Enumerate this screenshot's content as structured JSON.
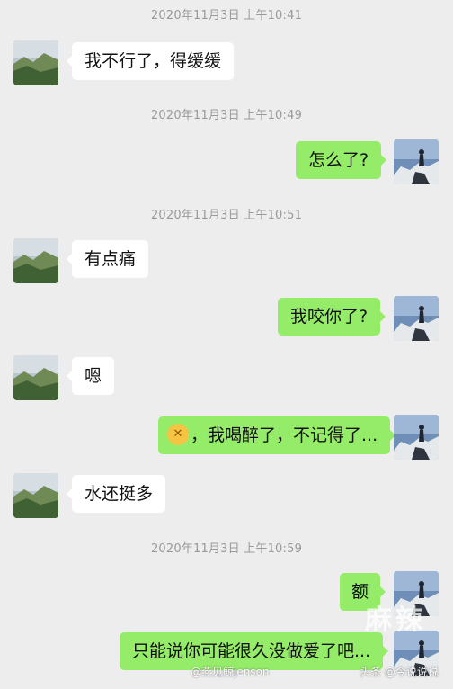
{
  "messages": [
    {
      "kind": "timestamp",
      "text": "2020年11月3日 上午10:41"
    },
    {
      "kind": "incoming",
      "text": "我不行了，得缓缓"
    },
    {
      "kind": "timestamp",
      "text": "2020年11月3日 上午10:49"
    },
    {
      "kind": "outgoing",
      "text": "怎么了?"
    },
    {
      "kind": "timestamp",
      "text": "2020年11月3日 上午10:51"
    },
    {
      "kind": "incoming",
      "text": "有点痛"
    },
    {
      "kind": "outgoing",
      "text": "我咬你了?"
    },
    {
      "kind": "incoming",
      "text": "嗯"
    },
    {
      "kind": "outgoing",
      "text": "，我喝醉了，不记得了...",
      "emoji": "dizzy-face-emoji"
    },
    {
      "kind": "incoming",
      "text": "水还挺多"
    },
    {
      "kind": "timestamp",
      "text": "2020年11月3日 上午10:59"
    },
    {
      "kind": "outgoing",
      "text": "额"
    },
    {
      "kind": "outgoing",
      "text": "只能说你可能很久没做爱了吧..."
    }
  ],
  "watermarks": {
    "logo": "麻辣",
    "weibo": "@燕见鲸jenson",
    "toutiao": "头条 @今说说说"
  },
  "colors": {
    "background": "#ededed",
    "outgoing_bubble": "#95ec69",
    "incoming_bubble": "#ffffff",
    "timestamp": "#9a9a9a"
  }
}
